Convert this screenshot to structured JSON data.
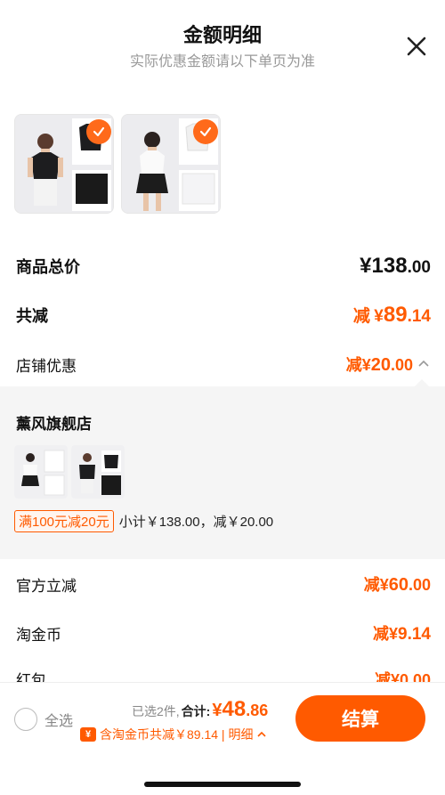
{
  "header": {
    "title": "金额明细",
    "subtitle": "实际优惠金额请以下单页为准"
  },
  "summary": {
    "total_label": "商品总价",
    "total_yen": "¥",
    "total_int": "138",
    "total_dec": ".00",
    "reduce_label": "共减",
    "reduce_prefix": "减",
    "reduce_yen": "¥",
    "reduce_int": "89",
    "reduce_dec": ".14",
    "shop_discount_label": "店铺优惠",
    "shop_discount_prefix": "减",
    "shop_discount_yen": "¥",
    "shop_discount_int": "20",
    "shop_discount_dec": ".00"
  },
  "shop": {
    "name": "薰风旗舰店",
    "promo_tag": "满100元减20元",
    "subtotal": "小计￥138.00，减￥20.00"
  },
  "official": {
    "label": "官方立减",
    "prefix": "减",
    "yen": "¥",
    "int": "60",
    "dec": ".00"
  },
  "coins": {
    "label": "淘金币",
    "prefix": "减",
    "yen": "¥",
    "value": "9.14"
  },
  "redpack": {
    "label": "红包",
    "value": "减¥0.00"
  },
  "bottom": {
    "select_all": "全选",
    "selected_count": "已选2件,",
    "total_label": "合计:",
    "total_yen": "¥",
    "total_int": "48",
    "total_dec": ".86",
    "coin_icon": "¥",
    "coin_text": "含淘金币共减￥89.14 | 明细",
    "checkout": "结算"
  },
  "colors": {
    "accent": "#ff5a00",
    "check": "#ff6a1a"
  }
}
